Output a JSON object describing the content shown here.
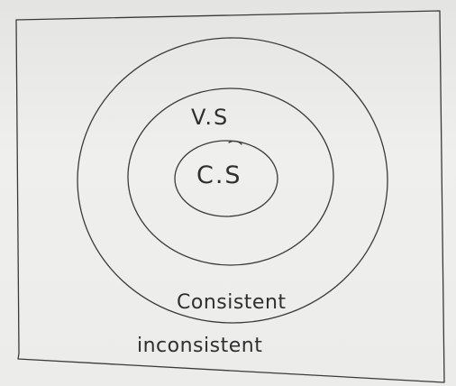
{
  "diagram": {
    "labels": {
      "inner": "C.S",
      "middle": "V.S",
      "outer_inside": "Consistent",
      "outer_outside": "inconsistent"
    }
  }
}
